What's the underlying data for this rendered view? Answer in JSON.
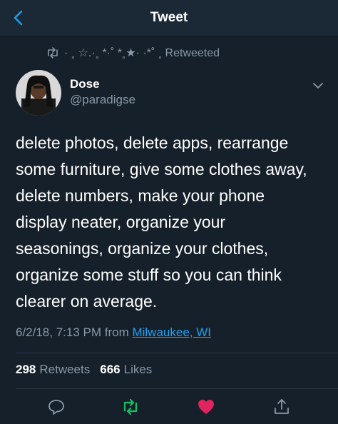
{
  "header": {
    "title": "Tweet"
  },
  "retweet_context": {
    "text": "· ˳ ☆.·˳  *·˚ *˳★·    ·*˚ ˳ Retweeted"
  },
  "author": {
    "display_name": "Dose",
    "handle": "@paradigse"
  },
  "tweet": {
    "text": "delete photos, delete apps, rearrange\nsome furniture, give some clothes away,\ndelete numbers, make your phone\ndisplay neater, organize your\nseasonings, organize your clothes,\norganize some stuff so you can think\nclearer on average.",
    "timestamp": "6/2/18, 7:13 PM from ",
    "location": "Milwaukee, WI"
  },
  "stats": {
    "retweets_count": "298",
    "retweets_label": "Retweets",
    "likes_count": "666",
    "likes_label": "Likes"
  },
  "colors": {
    "background": "#15202b",
    "accent": "#1da1f2",
    "muted": "#8899a6",
    "retweet_green": "#17bf63",
    "like_pink": "#e0245e"
  },
  "icons": {
    "back": "chevron-left-icon",
    "reply": "reply-icon",
    "retweet": "retweet-icon",
    "like": "heart-icon",
    "share": "share-icon",
    "more": "chevron-down-icon"
  }
}
